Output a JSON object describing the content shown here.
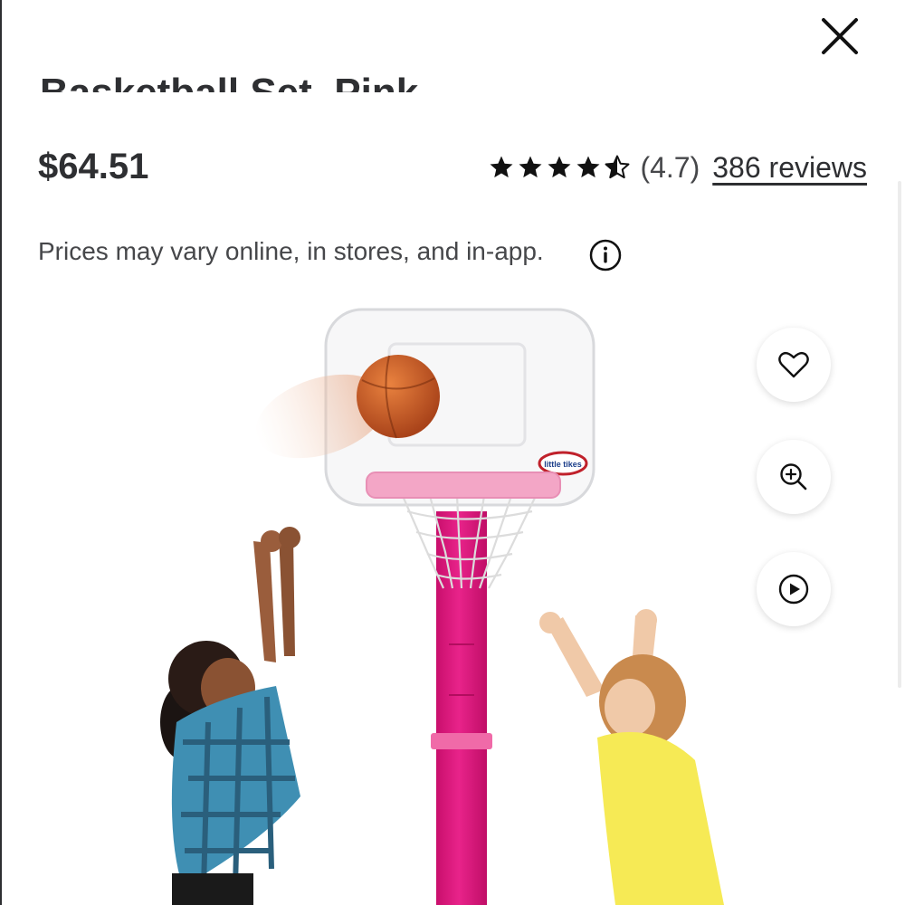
{
  "product": {
    "title_fragment": "Basketball Set, Pink",
    "price": "$64.51",
    "rating": {
      "stars_filled": 4.5,
      "stars_max": 5,
      "value_text": "(4.7)",
      "reviews_text": "386 reviews"
    },
    "price_note": "Prices may vary online, in stores, and in-app.",
    "image_logo_text": "little tikes"
  },
  "icons": {
    "close": "close-icon",
    "info": "info-icon",
    "favorite": "heart-icon",
    "zoom": "zoom-in-icon",
    "video": "play-icon"
  },
  "colors": {
    "text": "#2e2f32",
    "pole_pink": "#e2147e",
    "rim_pink": "#f3a6c6",
    "ball_orange": "#c8561b"
  }
}
